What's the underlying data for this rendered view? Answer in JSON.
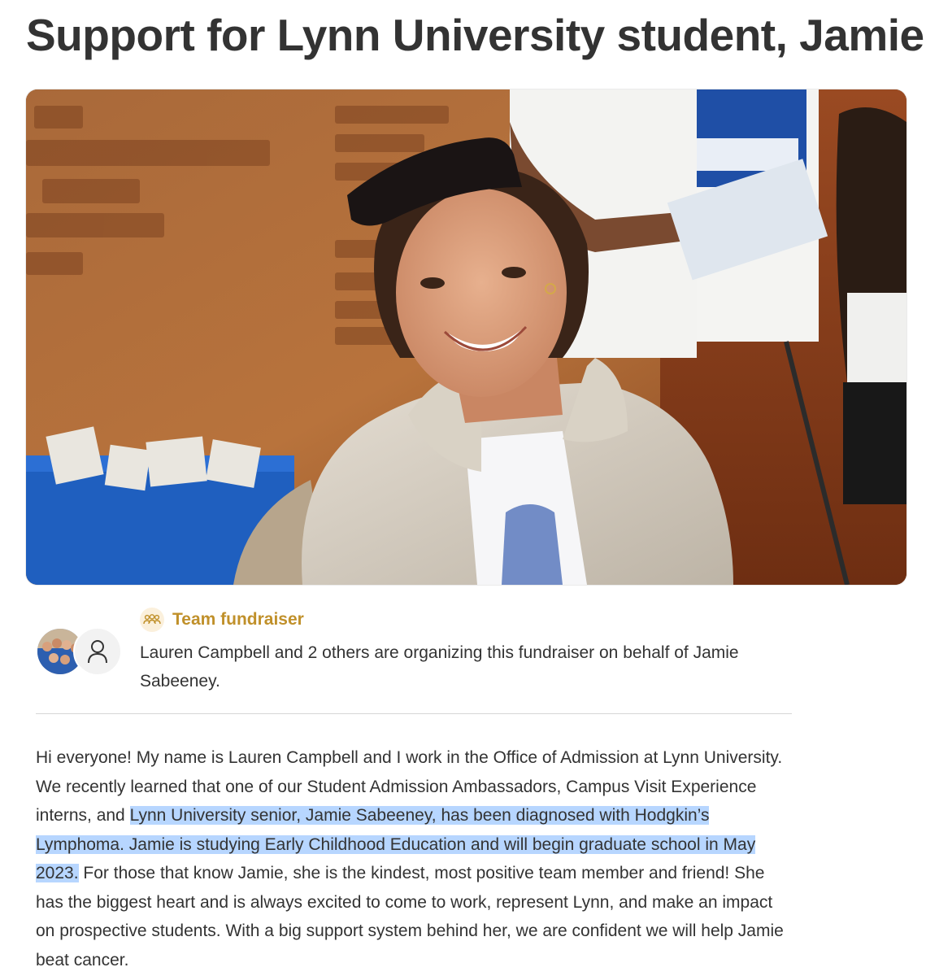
{
  "page": {
    "title": "Support for Lynn University student, Jamie!"
  },
  "hero": {
    "alt": "Smiling student in a grey fleece jacket with sunglasses on her head"
  },
  "organizer": {
    "badge_label": "Team fundraiser",
    "badge_icon": "people-group-icon",
    "text": "Lauren Campbell and 2 others are organizing this fundraiser on behalf of Jamie Sabeeney."
  },
  "story": {
    "part1": "Hi everyone! My name is Lauren Campbell and I work in the Office of Admission at Lynn University. We recently learned that one of our Student Admission Ambassadors, Campus Visit Experience interns, and ",
    "highlighted": "Lynn University senior, Jamie Sabeeney, has been diagnosed with Hodgkin’s Lymphoma. Jamie is studying Early Childhood Education and will begin graduate school in May 2023.",
    "part2": " For those that know Jamie, she is the kindest, most positive team member and friend! She has the biggest heart and is always excited to come to work, represent Lynn, and make an impact on prospective students. With a big support system behind her, we are confident we will help Jamie beat cancer."
  },
  "colors": {
    "text": "#333333",
    "accent_gold": "#c0902a",
    "selection_highlight": "#b7d6ff",
    "divider": "#d6d6d6"
  }
}
